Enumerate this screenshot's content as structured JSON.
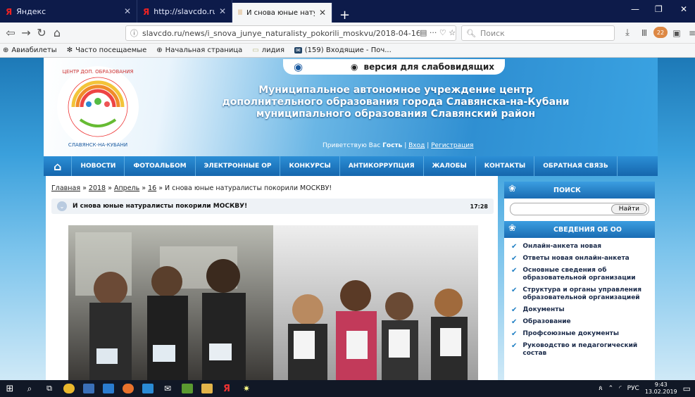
{
  "browser": {
    "tabs": [
      {
        "label": "Яндекс",
        "active": false
      },
      {
        "label": "http://slavcdo.ru/news/i_snov",
        "active": false
      },
      {
        "label": "И снова юные натуралисты п",
        "active": true
      }
    ],
    "url": "slavcdo.ru/news/i_snova_junye_naturalisty_pokorili_moskvu/2018-04-16-",
    "search_placeholder": "Поиск",
    "bookmarks": [
      "Авиабилеты",
      "Часто посещаемые",
      "Начальная страница",
      "лидия",
      "(159) Входящие - Поч..."
    ],
    "badge_count": "22"
  },
  "site": {
    "accessibility_label": "версия для слабовидящих",
    "title_line1": "Муниципальное автономное учреждение центр",
    "title_line2": "дополнительного образования города Славянска-на-Кубани",
    "title_line3": "муниципального образования Славянский район",
    "logo_text": "ЦЕНТР ДОПОЛНИТЕЛЬНОГО ОБРАЗОВАНИЯ г. СЛАВЯНСК-НА-КУБАНИ",
    "greeting_prefix": "Приветствую Вас ",
    "greeting_user": "Гость",
    "greeting_sep1": " | ",
    "login": "Вход",
    "greeting_sep2": " | ",
    "register": "Регистрация"
  },
  "menu": [
    "НОВОСТИ",
    "ФОТОАЛЬБОМ",
    "ЭЛЕКТРОННЫЕ ОР",
    "КОНКУРСЫ",
    "АНТИКОРРУПЦИЯ",
    "ЖАЛОБЫ",
    "КОНТАКТЫ",
    "ОБРАТНАЯ СВЯЗЬ"
  ],
  "breadcrumb": {
    "home": "Главная",
    "year": "2018",
    "month": "Апрель",
    "day": "16",
    "sep": " » ",
    "current": "И снова юные натуралисты покорили МОСКВУ!"
  },
  "post": {
    "title": "И снова юные натуралисты покорили МОСКВУ!",
    "time": "17:28"
  },
  "sidebar": {
    "search_title": "ПОИСК",
    "search_button": "Найти",
    "info_title": "СВЕДЕНИЯ ОБ ОО",
    "items": [
      "Онлайн-анкета новая",
      "Ответы новая онлайн-анкета",
      "Основные сведения об образовательной организации",
      "Структура и органы управления образовательной организацией",
      "Документы",
      "Образование",
      "Профсоюзные документы",
      "Руководство и педагогический состав"
    ]
  },
  "taskbar": {
    "lang": "РУС",
    "time": "9:43",
    "date": "13.02.2019"
  },
  "colors": {
    "menu": "#1a73b8",
    "accent": "#1f7fc4"
  }
}
